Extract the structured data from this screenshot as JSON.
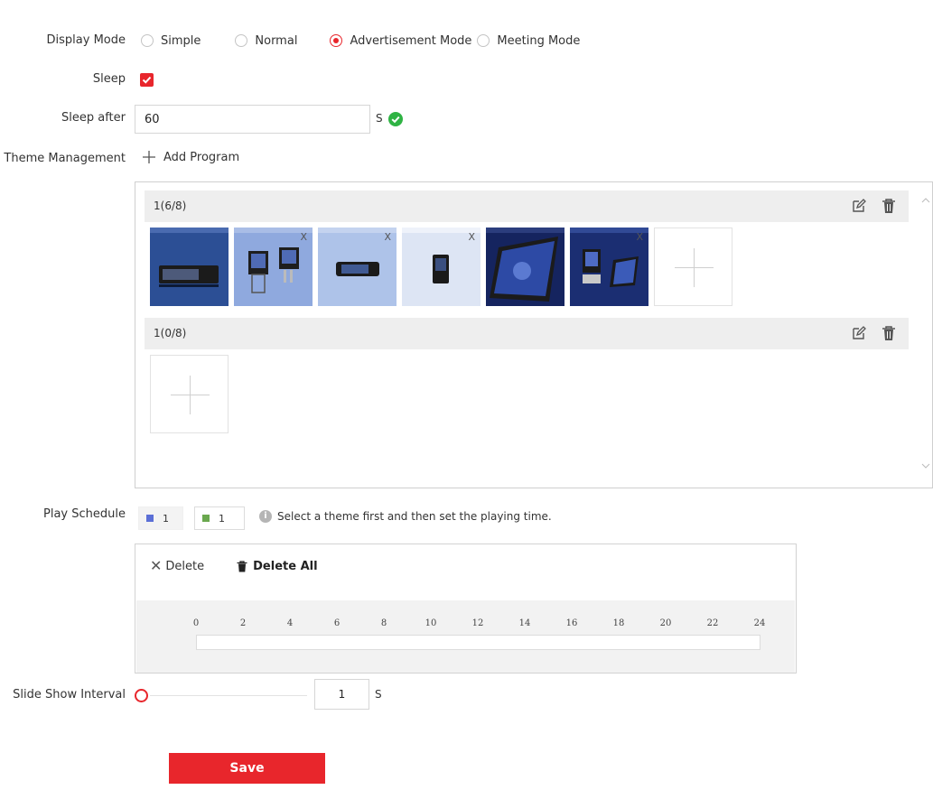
{
  "display_mode": {
    "label": "Display Mode",
    "options": [
      {
        "label": "Simple",
        "checked": false
      },
      {
        "label": "Normal",
        "checked": false
      },
      {
        "label": "Advertisement Mode",
        "checked": true
      },
      {
        "label": "Meeting Mode",
        "checked": false
      }
    ]
  },
  "sleep": {
    "label": "Sleep",
    "checked": true
  },
  "sleep_after": {
    "label": "Sleep after",
    "value": "60",
    "unit": "S"
  },
  "theme_management": {
    "label": "Theme Management",
    "add_label": "Add Program",
    "themes": [
      {
        "title": "1(6/8)",
        "thumbnails": [
          "device-display-1",
          "device-display-2",
          "device-display-3",
          "device-display-4",
          "device-tablet",
          "device-display-5"
        ]
      },
      {
        "title": "1(0/8)",
        "thumbnails": []
      }
    ]
  },
  "play_schedule": {
    "label": "Play Schedule",
    "legend": [
      {
        "value": "1",
        "color": "#5b6fd6"
      },
      {
        "value": "1",
        "color": "#6aa84f"
      }
    ],
    "hint": "Select a theme first and then set the playing time.",
    "delete_label": "Delete",
    "delete_all_label": "Delete All",
    "ticks": [
      "0",
      "2",
      "4",
      "6",
      "8",
      "10",
      "12",
      "14",
      "16",
      "18",
      "20",
      "22",
      "24"
    ]
  },
  "slide_show": {
    "label": "Slide Show Interval",
    "value": "1",
    "unit": "S"
  },
  "save_label": "Save",
  "colors": {
    "accent": "#e8262c",
    "success": "#2fb344",
    "panel_header": "#eeeeee"
  }
}
